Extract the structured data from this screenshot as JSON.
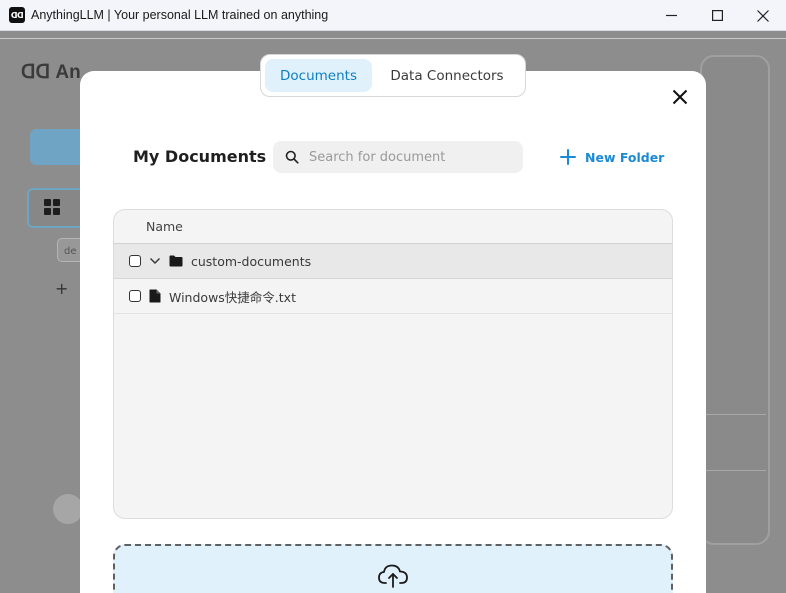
{
  "window": {
    "logo_text": "ᗡᗡ",
    "title": "AnythingLLM | Your personal LLM trained on anything",
    "controls": [
      "minimize-icon",
      "maximize-icon",
      "close-icon"
    ]
  },
  "background": {
    "logo_text": "ᗡᗡ An",
    "thread_text": "de"
  },
  "modal": {
    "tabs": [
      {
        "label": "Documents",
        "active": true
      },
      {
        "label": "Data Connectors",
        "active": false
      }
    ],
    "heading": "My Documents",
    "search": {
      "placeholder": "Search for document",
      "value": ""
    },
    "new_folder_label": "New Folder",
    "table": {
      "column_header": "Name",
      "rows": [
        {
          "type": "folder",
          "name": "custom-documents",
          "expanded": true,
          "checked": false
        },
        {
          "type": "file",
          "name": "Windows快捷命令.txt",
          "checked": false
        }
      ]
    },
    "upload_icon": "cloud-upload-icon"
  },
  "colors": {
    "accent": "#1a8ad4",
    "active_tab_bg": "#e1f1fc",
    "active_tab_text": "#0d7fc1",
    "upload_bg": "#e1f1fc"
  }
}
